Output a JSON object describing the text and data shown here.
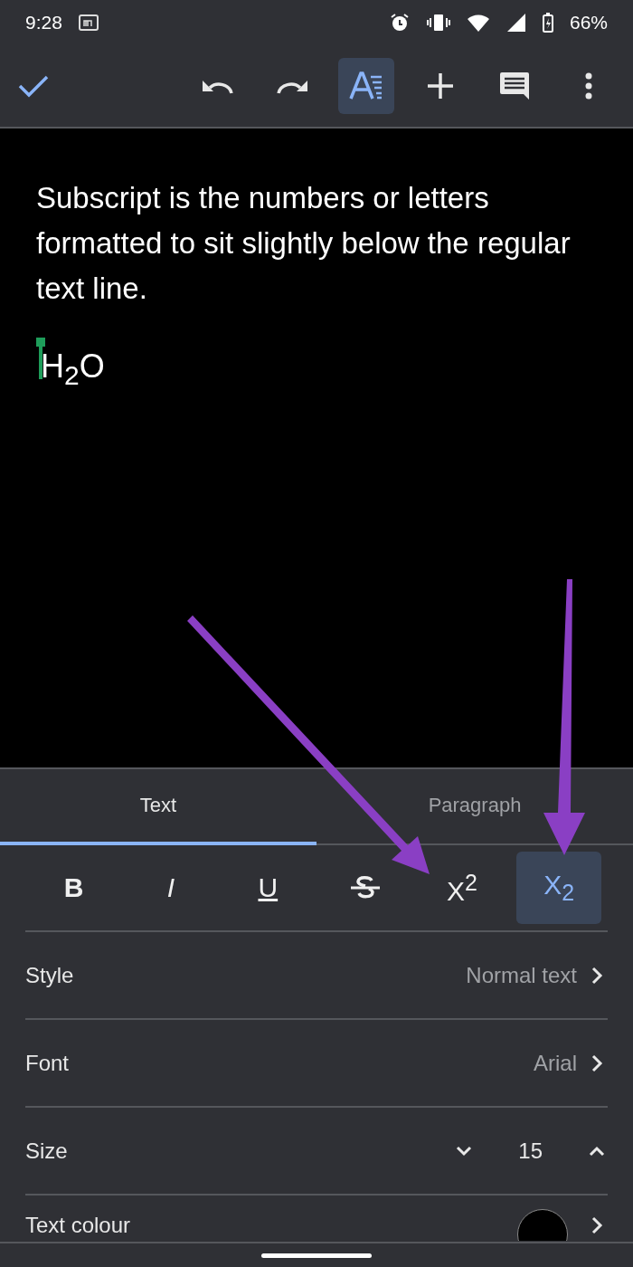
{
  "status_bar": {
    "time": "9:28",
    "battery": "66%"
  },
  "toolbar": {
    "format_selected": true
  },
  "document": {
    "paragraph": "Subscript is the numbers or letters formatted to sit slightly below the regular text line.",
    "formula": "H$_{2}$O"
  },
  "tabs": [
    {
      "label": "Text",
      "selected": true
    },
    {
      "label": "Paragraph",
      "selected": false
    }
  ],
  "format_buttons": [
    {
      "kind": "bold",
      "label": "B",
      "selected": false
    },
    {
      "kind": "italic",
      "label": "I",
      "selected": false
    },
    {
      "kind": "underline",
      "label": "U",
      "selected": false
    },
    {
      "kind": "strike",
      "selected": false
    },
    {
      "kind": "superscript",
      "label": "X$^{2}$",
      "selected": false
    },
    {
      "kind": "subscript",
      "label": "X$_{2}$",
      "selected": true
    }
  ],
  "settings": [
    {
      "kind": "link",
      "label": "Style",
      "value": "Normal text"
    },
    {
      "kind": "link",
      "label": "Font",
      "value": "Arial"
    },
    {
      "kind": "stepper",
      "label": "Size",
      "value": "15"
    },
    {
      "kind": "color",
      "label": "Text colour",
      "color": "#000000"
    }
  ]
}
